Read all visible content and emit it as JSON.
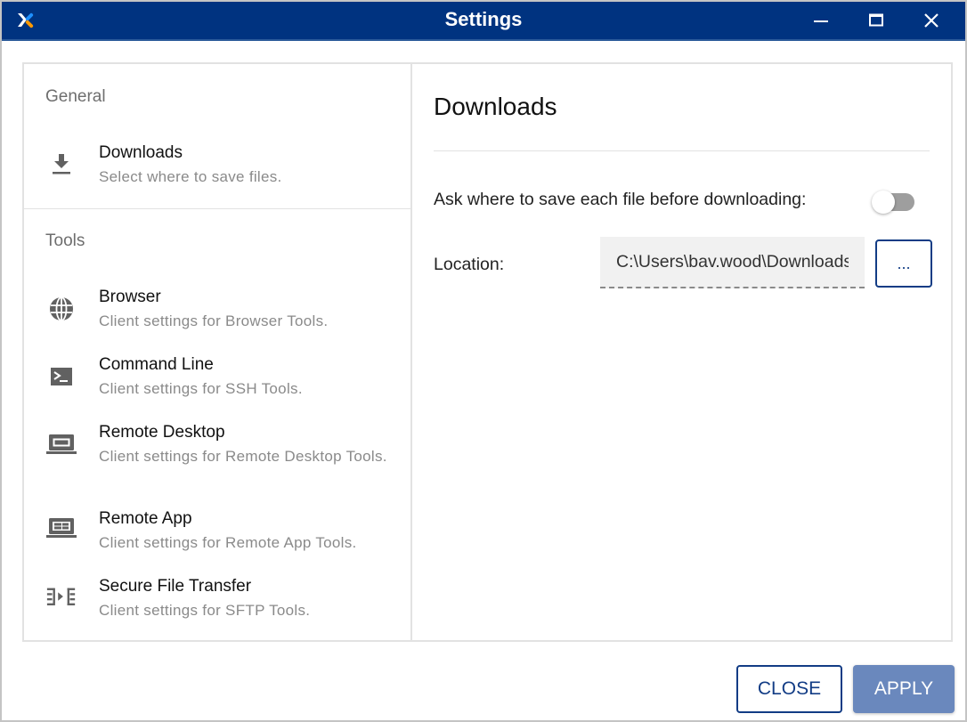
{
  "window": {
    "title": "Settings",
    "controls": {
      "minimize_icon": "minimize-icon",
      "maximize_icon": "maximize-icon",
      "close_icon": "close-icon"
    }
  },
  "sidebar": {
    "sections": [
      {
        "label": "General",
        "items": [
          {
            "icon": "download-icon",
            "title": "Downloads",
            "description": "Select where to save files.",
            "selected": true
          }
        ]
      },
      {
        "label": "Tools",
        "items": [
          {
            "icon": "globe-icon",
            "title": "Browser",
            "description": "Client settings for Browser Tools."
          },
          {
            "icon": "terminal-icon",
            "title": "Command Line",
            "description": "Client settings for SSH Tools."
          },
          {
            "icon": "laptop-icon",
            "title": "Remote Desktop",
            "description": "Client settings for Remote Desktop Tools."
          },
          {
            "icon": "laptop-apps-icon",
            "title": "Remote App",
            "description": "Client settings for Remote App Tools."
          },
          {
            "icon": "file-transfer-icon",
            "title": "Secure File Transfer",
            "description": "Client settings for SFTP Tools."
          }
        ]
      }
    ]
  },
  "content": {
    "title": "Downloads",
    "ask_label": "Ask where to save each file before downloading:",
    "ask_toggle_on": false,
    "location_label": "Location:",
    "location_value": "C:\\Users\\bav.wood\\Downloads",
    "browse_label": "..."
  },
  "footer": {
    "close_label": "CLOSE",
    "apply_label": "APPLY"
  },
  "colors": {
    "titlebar": "#003380",
    "accent": "#123c85",
    "apply_disabled": "#6a88bd",
    "logo_blue": "#1e90ff",
    "logo_orange": "#ff9900"
  }
}
